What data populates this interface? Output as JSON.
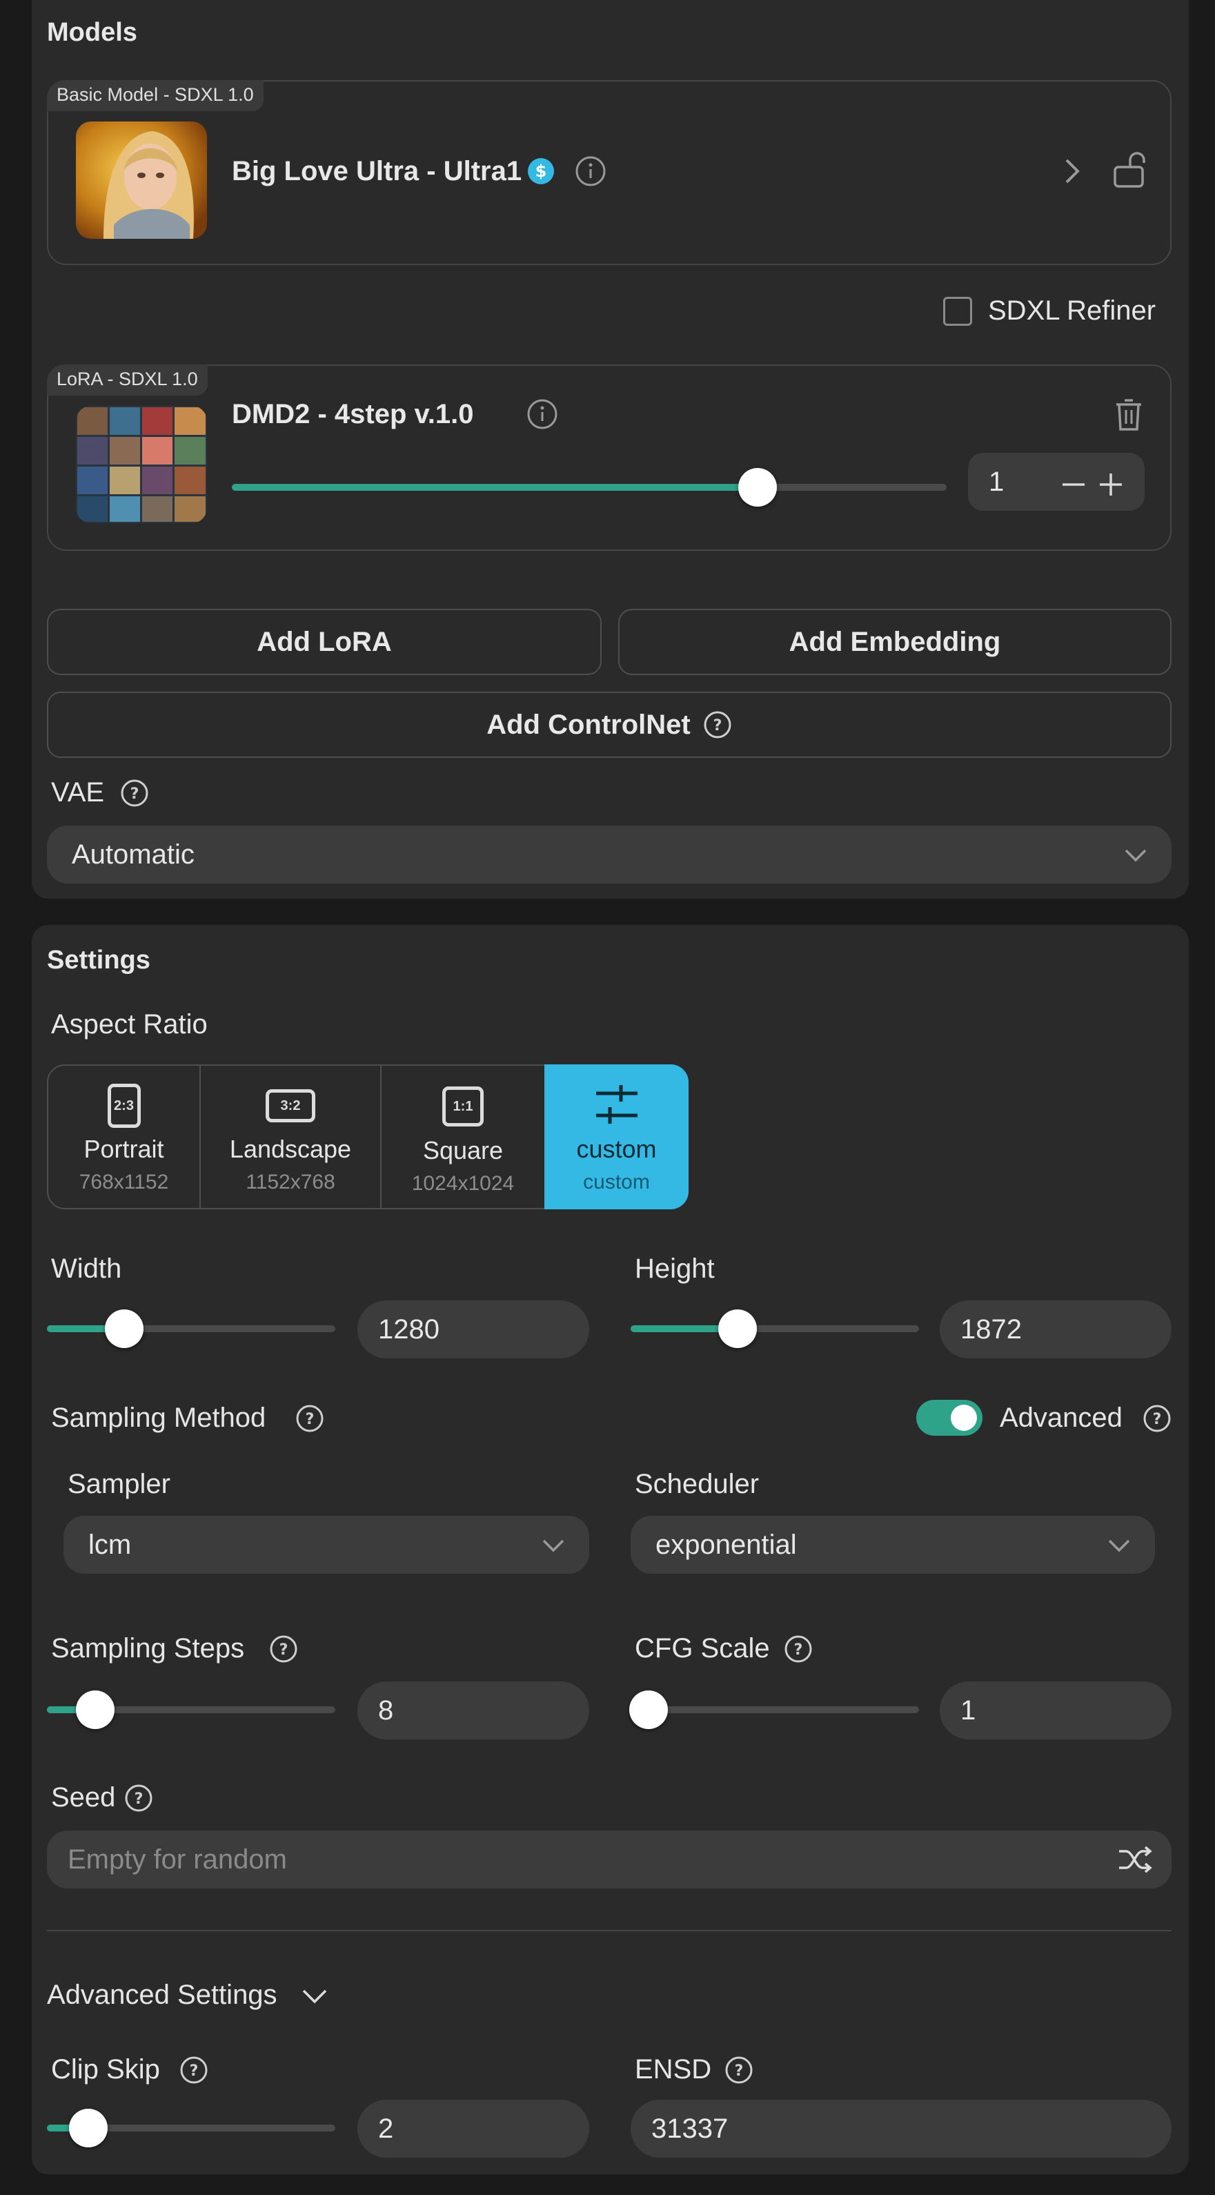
{
  "models": {
    "title": "Models",
    "basic_model": {
      "tag": "Basic Model - SDXL 1.0",
      "name": "Big Love Ultra - Ultra1"
    },
    "refiner_label": "SDXL Refiner",
    "lora": {
      "tag": "LoRA - SDXL 1.0",
      "name": "DMD2 - 4step v.1.0",
      "weight": "1",
      "weight_fraction": 0.74
    },
    "buttons": {
      "add_lora": "Add LoRA",
      "add_embedding": "Add Embedding",
      "add_controlnet": "Add ControlNet"
    },
    "vae": {
      "label": "VAE",
      "value": "Automatic"
    }
  },
  "settings": {
    "title": "Settings",
    "aspect_ratio": {
      "label": "Aspect Ratio",
      "options": [
        {
          "icon": "2:3",
          "name": "Portrait",
          "size": "768x1152"
        },
        {
          "icon": "3:2",
          "name": "Landscape",
          "size": "1152x768"
        },
        {
          "icon": "1:1",
          "name": "Square",
          "size": "1024x1024"
        },
        {
          "icon": "custom-sliders-icon",
          "name": "custom",
          "size": "custom"
        }
      ],
      "selected": "custom"
    },
    "width": {
      "label": "Width",
      "value": "1280"
    },
    "height": {
      "label": "Height",
      "value": "1872"
    },
    "sampling_method": {
      "label": "Sampling Method",
      "advanced_label": "Advanced",
      "advanced_on": true
    },
    "sampler": {
      "label": "Sampler",
      "value": "lcm"
    },
    "scheduler": {
      "label": "Scheduler",
      "value": "exponential"
    },
    "steps": {
      "label": "Sampling Steps",
      "value": "8"
    },
    "cfg": {
      "label": "CFG Scale",
      "value": "1"
    },
    "seed": {
      "label": "Seed",
      "placeholder": "Empty for random"
    },
    "advanced_settings": {
      "label": "Advanced Settings"
    },
    "clip_skip": {
      "label": "Clip Skip",
      "value": "2"
    },
    "ensd": {
      "label": "ENSD",
      "value": "31337"
    }
  },
  "colors": {
    "accent": "#2ea389",
    "selected": "#33b9e3",
    "panel": "#2a2a2a",
    "background": "#1a1a1a"
  }
}
